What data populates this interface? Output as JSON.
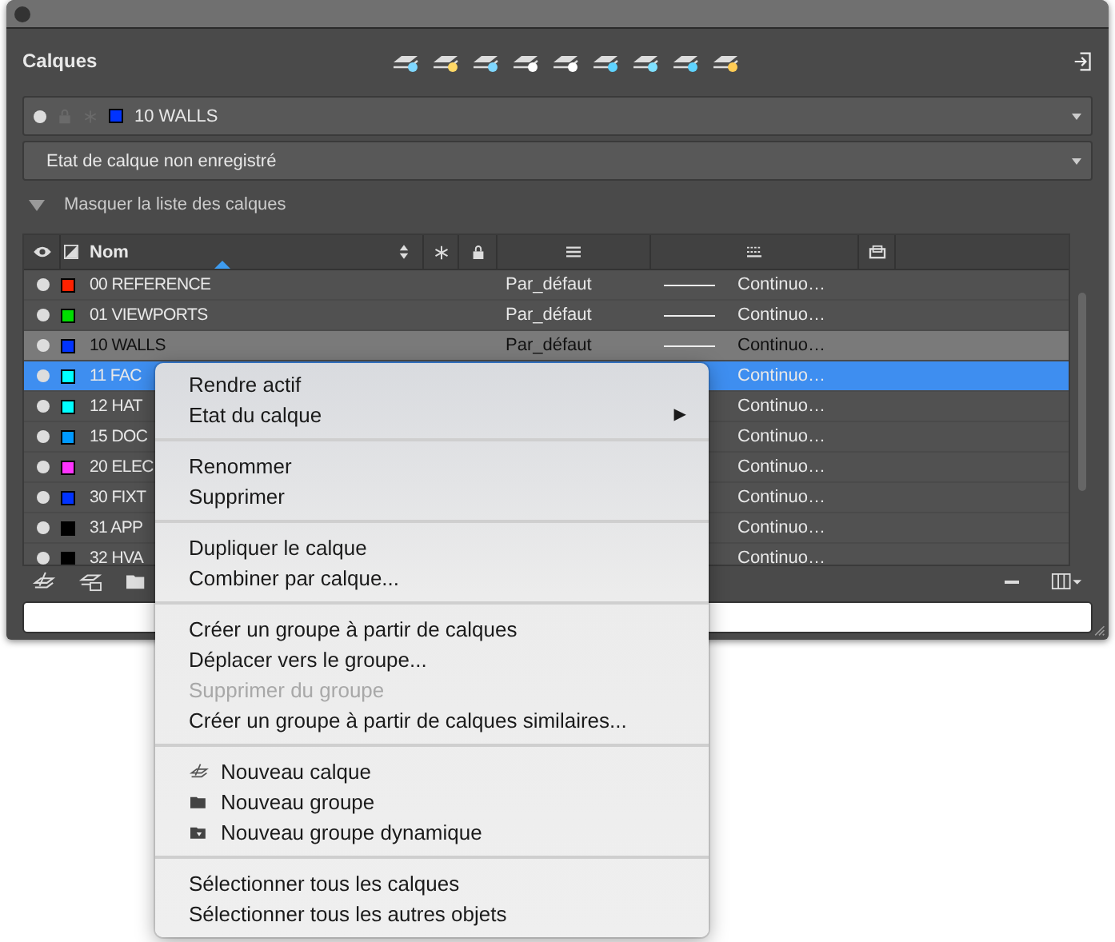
{
  "panel": {
    "title": "Calques"
  },
  "current_layer": {
    "name": "10 WALLS",
    "color": "#0033ff"
  },
  "layer_state": {
    "value": "Etat de calque non enregistré"
  },
  "toggle": {
    "label": "Masquer la liste des calques",
    "expanded": true
  },
  "table": {
    "columns": [
      {
        "kind": "eye"
      },
      {
        "kind": "color"
      },
      {
        "kind": "name",
        "label": "Nom"
      },
      {
        "kind": "freeze"
      },
      {
        "kind": "lock"
      },
      {
        "kind": "lineweight"
      },
      {
        "kind": "linetype"
      },
      {
        "kind": "plot"
      }
    ],
    "rows": [
      {
        "name": "00 REFERENCE",
        "color": "#ff2200",
        "lineweight": "Par_défaut",
        "linetype": "Continuo…",
        "current": false,
        "selected": false
      },
      {
        "name": "01 VIEWPORTS",
        "color": "#00dd00",
        "lineweight": "Par_défaut",
        "linetype": "Continuo…",
        "current": false,
        "selected": false
      },
      {
        "name": "10 WALLS",
        "color": "#0033ff",
        "lineweight": "Par_défaut",
        "linetype": "Continuo…",
        "current": true,
        "selected": false
      },
      {
        "name": "11 FAC",
        "color": "#00ffff",
        "linetype": "Continuo…",
        "current": false,
        "selected": true
      },
      {
        "name": "12 HAT",
        "color": "#00ffff",
        "linetype": "Continuo…",
        "current": false,
        "selected": false
      },
      {
        "name": "15 DOC",
        "color": "#0099ff",
        "linetype": "Continuo…",
        "current": false,
        "selected": false
      },
      {
        "name": "20 ELEC",
        "color": "#ff33ff",
        "linetype": "Continuo…",
        "current": false,
        "selected": false
      },
      {
        "name": "30 FIXT",
        "color": "#0033ff",
        "linetype": "Continuo…",
        "current": false,
        "selected": false
      },
      {
        "name": "31 APP",
        "color": "#000000",
        "linetype": "Continuo…",
        "current": false,
        "selected": false
      },
      {
        "name": "32 HVA",
        "color": "#000000",
        "linetype": "Continuo…",
        "current": false,
        "selected": false
      }
    ]
  },
  "context_menu": {
    "sections": [
      [
        {
          "label": "Rendre actif",
          "disabled": false
        },
        {
          "label": "Etat du calque",
          "disabled": false,
          "submenu_arrow": "▶"
        }
      ],
      [
        {
          "label": "Renommer",
          "disabled": false
        },
        {
          "label": "Supprimer",
          "disabled": false
        }
      ],
      [
        {
          "label": "Dupliquer le calque",
          "disabled": false
        },
        {
          "label": "Combiner par calque...",
          "disabled": false
        }
      ],
      [
        {
          "label": "Créer un groupe à partir de calques",
          "disabled": false
        },
        {
          "label": "Déplacer vers le groupe...",
          "disabled": false
        },
        {
          "label": "Supprimer du groupe",
          "disabled": true
        },
        {
          "label": "Créer un groupe à partir de calques similaires...",
          "disabled": false
        }
      ],
      [
        {
          "label": "Nouveau calque",
          "disabled": false,
          "kind": "layer"
        },
        {
          "label": "Nouveau groupe",
          "disabled": false,
          "kind": "folder"
        },
        {
          "label": "Nouveau groupe dynamique",
          "disabled": false,
          "kind": "dynamic-folder"
        }
      ],
      [
        {
          "label": "Sélectionner tous les calques",
          "disabled": false
        },
        {
          "label": "Sélectionner tous les autres objets",
          "disabled": false
        }
      ]
    ]
  }
}
